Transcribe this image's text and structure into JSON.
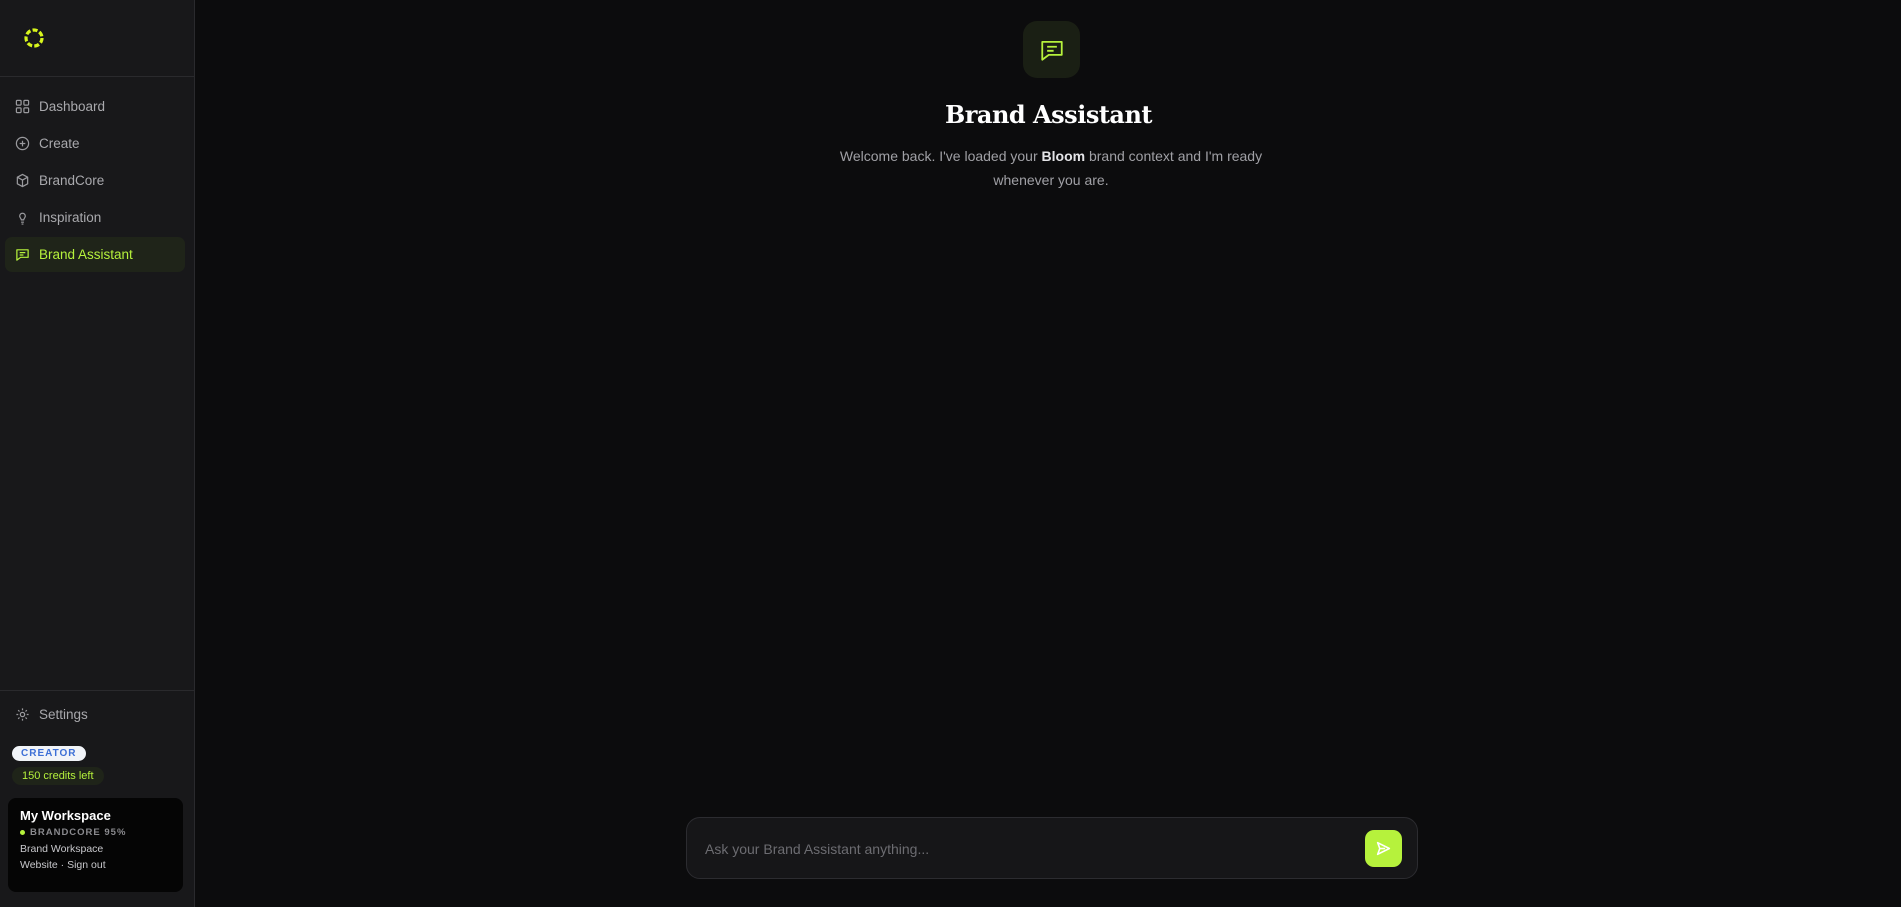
{
  "sidebar": {
    "logo": "bloom-logo",
    "items": [
      {
        "label": "Dashboard",
        "icon": "grid-icon"
      },
      {
        "label": "Create",
        "icon": "plus-circle-icon"
      },
      {
        "label": "BrandCore",
        "icon": "cube-icon"
      },
      {
        "label": "Inspiration",
        "icon": "lightbulb-icon"
      },
      {
        "label": "Brand Assistant",
        "icon": "chat-icon",
        "active": true
      }
    ],
    "settings": "Settings",
    "plan_badge": "CREATOR",
    "credits": "150 credits left",
    "workspace": {
      "title": "My Workspace",
      "status": "BRANDCORE 95%",
      "subtitle": "Brand Workspace",
      "link_website": "Website",
      "separator": " · ",
      "link_signout": "Sign out"
    }
  },
  "main": {
    "title": "Brand Assistant",
    "welcome_prefix": "Welcome back. I've loaded your ",
    "brand_name": "Bloom",
    "welcome_suffix": " brand context and I'm ready whenever you are.",
    "input_placeholder": "Ask your Brand Assistant anything..."
  },
  "colors": {
    "accent": "#b6f23c",
    "background": "#0c0c0d",
    "sidebar": "#18181a"
  }
}
